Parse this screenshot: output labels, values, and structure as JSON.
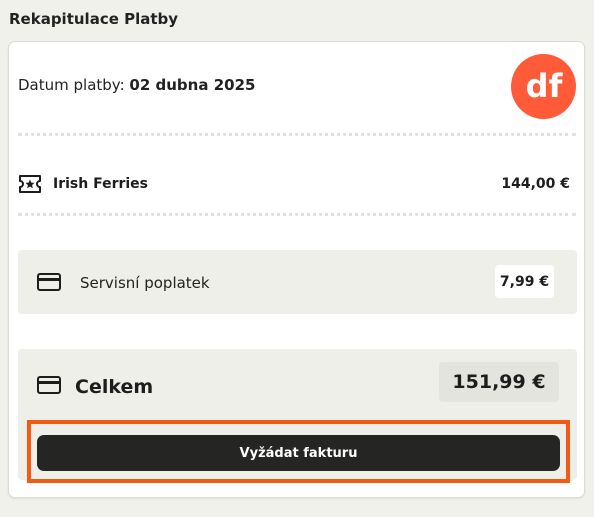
{
  "header": {
    "title": "Rekapitulace Platby"
  },
  "payment": {
    "date_label": "Datum platby:",
    "date_value": "02 dubna 2025"
  },
  "logo": {
    "text": "df",
    "color": "#ff5b38",
    "icon": "df-logo"
  },
  "items": [
    {
      "icon": "ticket-star-icon",
      "name": "Irish Ferries",
      "price": "144,00 €"
    }
  ],
  "fees": {
    "icon": "credit-card-icon",
    "label": "Servisní poplatek",
    "price": "7,99 €"
  },
  "total": {
    "icon": "credit-card-icon",
    "label": "Celkem",
    "price": "151,99 €",
    "button_label": "Vyžádat fakturu"
  },
  "colors": {
    "accent": "#ff5b38",
    "highlight": "#f55a13",
    "button": "#252523",
    "panel": "#efefe9",
    "background": "#f1f1ec"
  }
}
